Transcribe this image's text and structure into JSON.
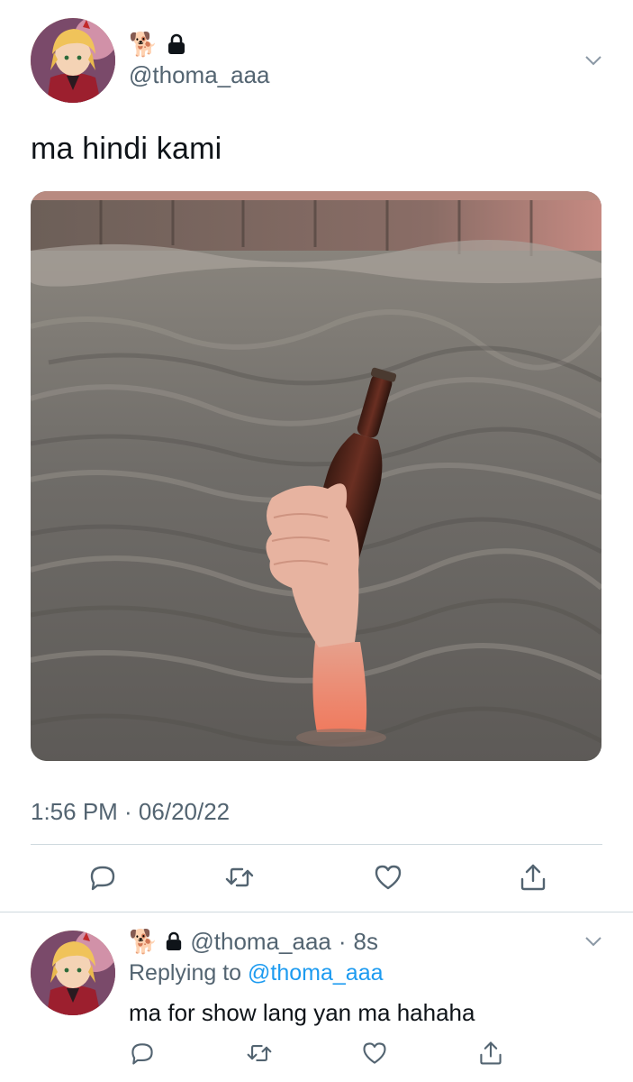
{
  "tweet": {
    "name_emoji": "🐕",
    "handle": "@thoma_aaa",
    "text": "ma hindi kami",
    "timestamp": "1:56 PM · 06/20/22",
    "actions": [
      "reply-icon",
      "retweet-icon",
      "like-icon",
      "share-icon"
    ]
  },
  "reply": {
    "name_emoji": "🐕",
    "handle": "@thoma_aaa",
    "separator": "·",
    "time": "8s",
    "replying_prefix": "Replying to",
    "replying_to": "@thoma_aaa",
    "text": "ma for show lang yan ma hahaha",
    "actions": [
      "reply-icon",
      "retweet-icon",
      "like-icon",
      "share-icon"
    ]
  },
  "colors": {
    "text_primary": "#0f1419",
    "text_secondary": "#536471",
    "link": "#1d9bf0",
    "divider": "#cfd9de"
  }
}
